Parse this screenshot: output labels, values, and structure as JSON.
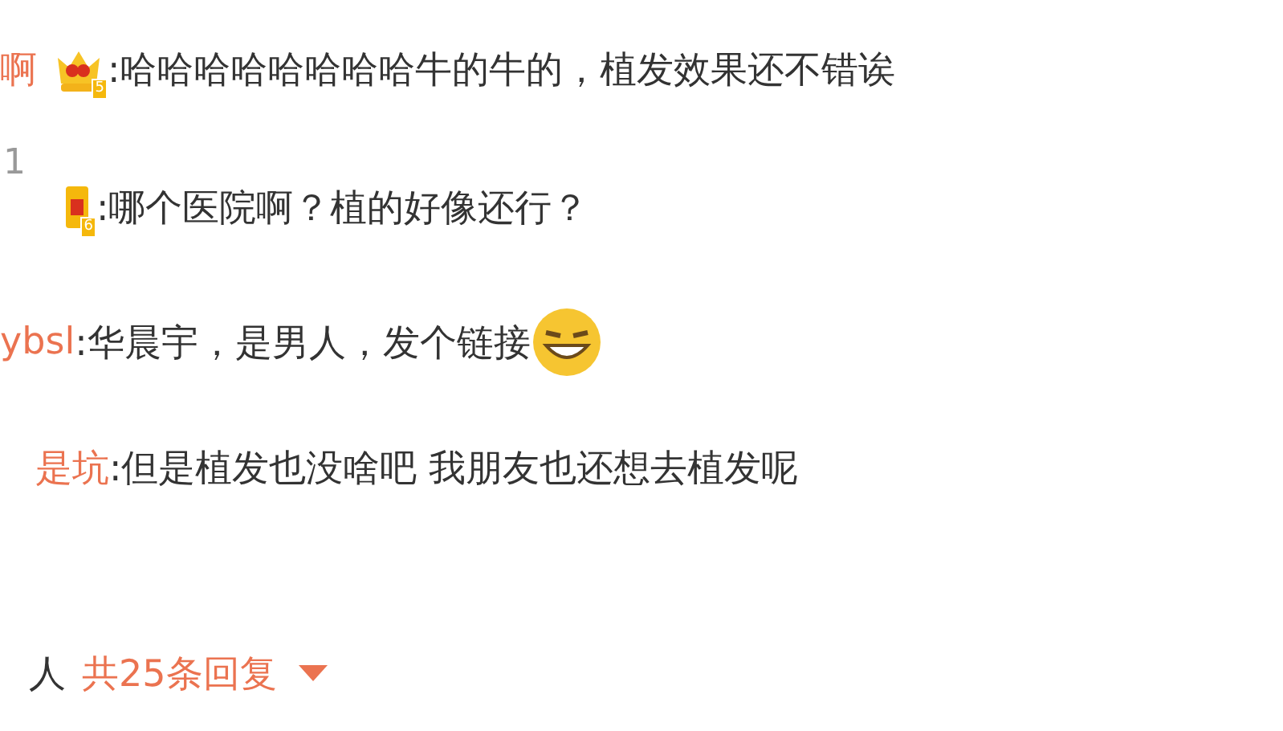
{
  "comments": [
    {
      "kind": "comment",
      "user": "啊",
      "badge": {
        "kind": "crown",
        "level": "5"
      },
      "text": ":哈哈哈哈哈哈哈哈牛的牛的，植发效果还不错诶"
    },
    {
      "kind": "count",
      "text": "1"
    },
    {
      "kind": "comment",
      "badge": {
        "kind": "flag",
        "level": "6"
      },
      "text": ":哪个医院啊？植的好像还行？"
    },
    {
      "kind": "comment",
      "user": "ybsl",
      "text": ":华晨宇，是男人，发个链接",
      "emoji": true
    },
    {
      "kind": "comment",
      "user": "是坑",
      "text": ":但是植发也没啥吧 我朋友也还想去植发呢"
    }
  ],
  "footer": {
    "names": "人",
    "replies": "共25条回复"
  }
}
